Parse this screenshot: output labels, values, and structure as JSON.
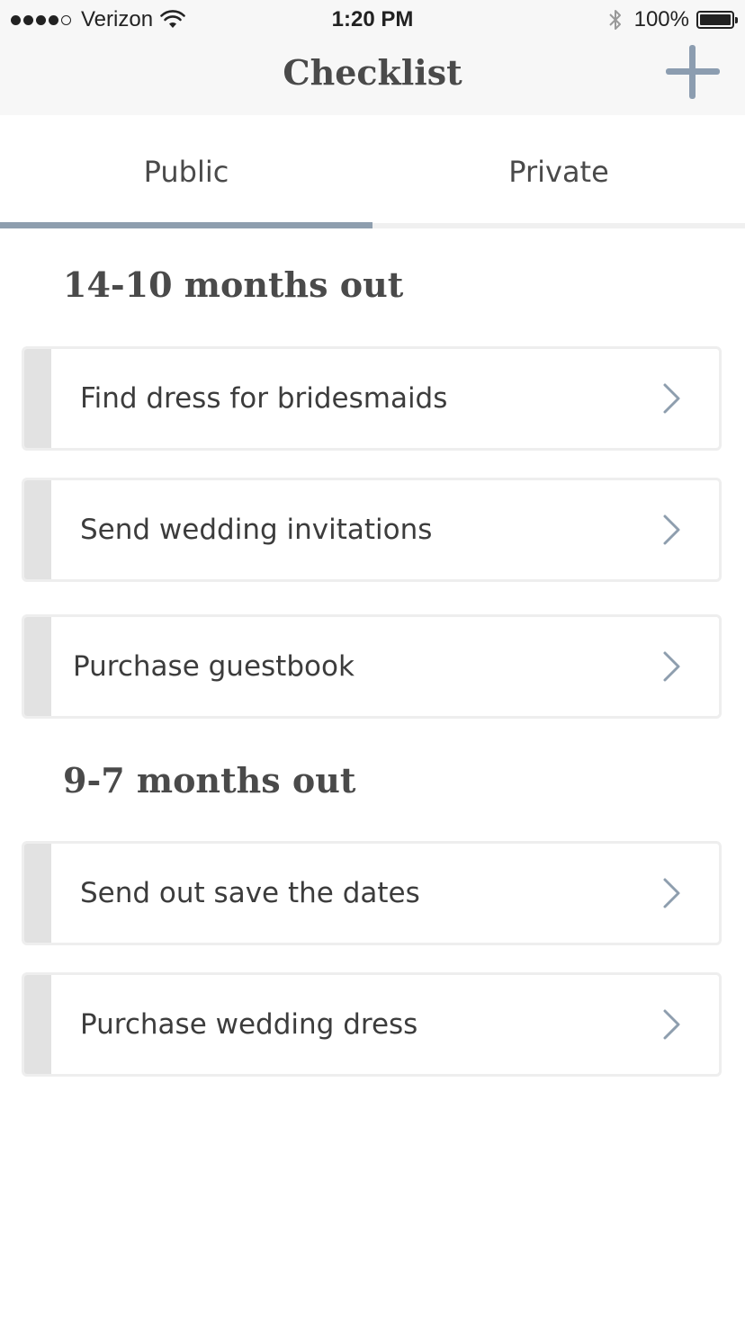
{
  "status_bar": {
    "carrier": "Verizon",
    "time": "1:20 PM",
    "battery": "100%",
    "signal_bars_filled": 4,
    "signal_bars_total": 5
  },
  "nav": {
    "title": "Checklist",
    "add_icon": "plus-icon"
  },
  "tabs": [
    {
      "label": "Public",
      "active": true
    },
    {
      "label": "Private",
      "active": false
    }
  ],
  "sections": [
    {
      "title": "14-10 months out",
      "items": [
        {
          "label": "Find dress for bridesmaids"
        },
        {
          "label": "Send wedding invitations"
        },
        {
          "label": "Purchase guestbook"
        }
      ]
    },
    {
      "title": "9-7 months out",
      "items": [
        {
          "label": "Send out save the dates"
        },
        {
          "label": "Purchase wedding dress"
        }
      ]
    }
  ],
  "colors": {
    "accent": "#8e9eae",
    "strip": "#e2e2e2",
    "text": "#3c3c3c"
  }
}
